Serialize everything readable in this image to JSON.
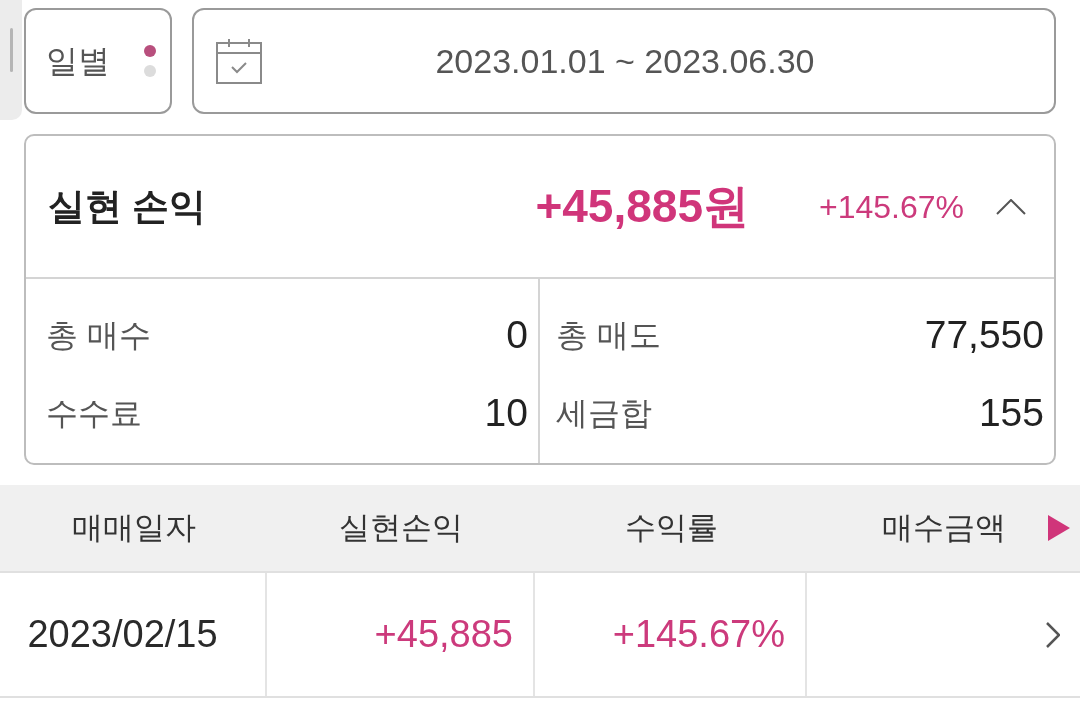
{
  "period": {
    "label": "일별",
    "options": [
      {
        "selected": true
      },
      {
        "selected": false
      }
    ]
  },
  "date_range": {
    "value": "2023.01.01 ~ 2023.06.30"
  },
  "summary": {
    "title": "실현 손익",
    "amount": "+45,885원",
    "rate": "+145.67%",
    "expanded": true,
    "stats": [
      {
        "label": "총 매수",
        "value": "0"
      },
      {
        "label": "총 매도",
        "value": "77,550"
      },
      {
        "label": "수수료",
        "value": "10"
      },
      {
        "label": "세금합",
        "value": "155"
      }
    ]
  },
  "table": {
    "columns": [
      "매매일자",
      "실현손익",
      "수익률",
      "매수금액"
    ],
    "more_columns": true,
    "rows": [
      {
        "cells": [
          "2023/02/15",
          "+45,885",
          "+145.67%"
        ]
      }
    ]
  }
}
